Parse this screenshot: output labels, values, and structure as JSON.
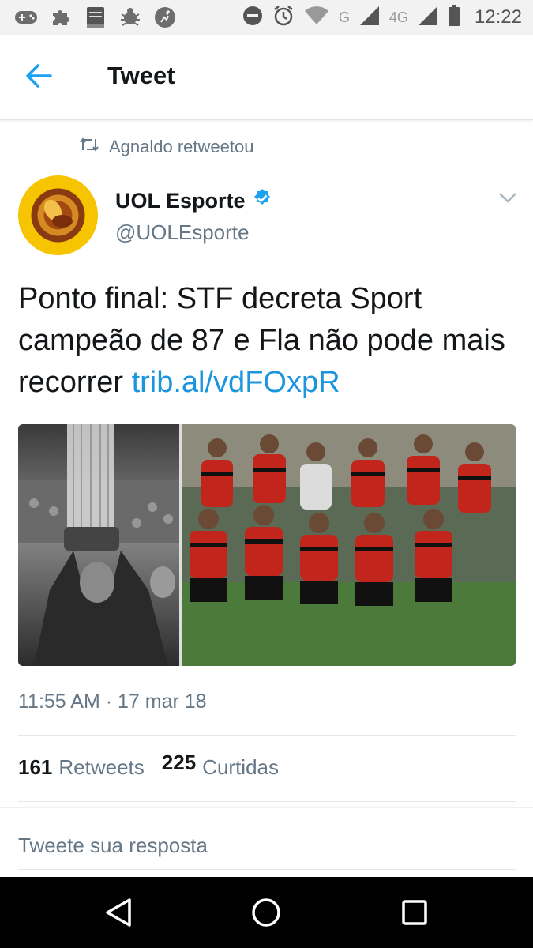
{
  "status_bar": {
    "time": "12:22",
    "network_g": "G",
    "network_4g": "4G",
    "icons": [
      "game-controller-icon",
      "puzzle-icon",
      "bible-app-icon",
      "bug-icon",
      "runner-icon",
      "do-not-disturb-icon",
      "alarm-icon",
      "wifi-icon",
      "signal-icon",
      "signal-icon",
      "battery-icon"
    ]
  },
  "header": {
    "title": "Tweet",
    "back_icon": "back-arrow-icon"
  },
  "tweet": {
    "retweet_context": "Agnaldo retweetou",
    "author_name": "UOL Esporte",
    "author_handle": "@UOLEsporte",
    "text": "Ponto final: STF decreta Sport campeão de 87 e Fla não pode mais recorrer ",
    "link": "trib.al/vdFOxpR",
    "timestamp": "11:55 AM · 17 mar 18",
    "retweets_count": "161",
    "retweets_label": "Retweets",
    "likes_count": "225",
    "likes_label": "Curtidas"
  },
  "reply": {
    "placeholder": "Tweete sua resposta"
  },
  "colors": {
    "link": "#1b95e0",
    "verified": "#1da1f2",
    "avatar": "#f6c400",
    "text": "#14171a",
    "secondary": "#657786"
  },
  "nav": {
    "icons": [
      "back-triangle-icon",
      "home-circle-icon",
      "recents-square-icon"
    ]
  }
}
